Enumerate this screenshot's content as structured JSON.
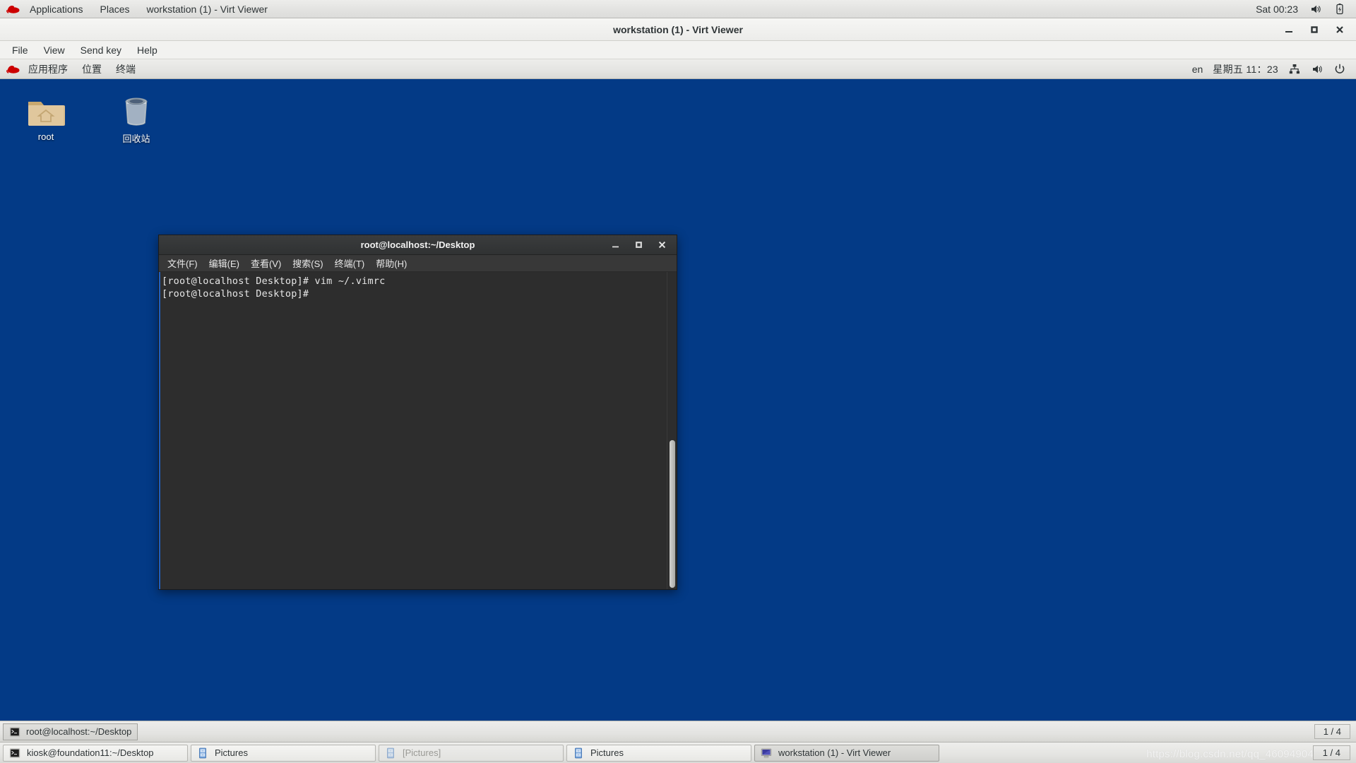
{
  "host": {
    "top_panel": {
      "logo_icon": "redhat-logo-icon",
      "menu": [
        {
          "label": "Applications",
          "name": "host-menu-applications"
        },
        {
          "label": "Places",
          "name": "host-menu-places"
        },
        {
          "label": "workstation (1) - Virt Viewer",
          "name": "host-menu-window-title"
        }
      ],
      "clock": "Sat 00:23",
      "tray": [
        {
          "icon": "volume-icon",
          "name": "host-tray-volume"
        },
        {
          "icon": "battery-charging-icon",
          "name": "host-tray-battery"
        }
      ]
    },
    "bottom_panel": {
      "tasks": [
        {
          "label": "kiosk@foundation11:~/Desktop",
          "icon": "terminal-icon",
          "state": "normal"
        },
        {
          "label": "Pictures",
          "icon": "file-manager-icon",
          "state": "normal"
        },
        {
          "label": "[Pictures]",
          "icon": "file-manager-icon",
          "state": "minimized"
        },
        {
          "label": "Pictures",
          "icon": "file-manager-icon",
          "state": "normal"
        },
        {
          "label": "workstation (1) - Virt Viewer",
          "icon": "display-icon",
          "state": "active"
        }
      ],
      "workspace_indicator": "1 / 4",
      "watermark": "https://blog.csdn.net/qq_46094904"
    }
  },
  "virt_viewer": {
    "title": "workstation (1) - Virt Viewer",
    "window_buttons": [
      {
        "icon": "minimize-icon",
        "name": "virt-viewer-minimize-button"
      },
      {
        "icon": "maximize-icon",
        "name": "virt-viewer-maximize-button"
      },
      {
        "icon": "close-icon",
        "name": "virt-viewer-close-button"
      }
    ],
    "menu": [
      {
        "label": "File",
        "name": "virt-viewer-menu-file"
      },
      {
        "label": "View",
        "name": "virt-viewer-menu-view"
      },
      {
        "label": "Send key",
        "name": "virt-viewer-menu-send-key"
      },
      {
        "label": "Help",
        "name": "virt-viewer-menu-help"
      }
    ]
  },
  "guest": {
    "desktop_background": "#033a86",
    "top_panel": {
      "logo_icon": "redhat-logo-icon",
      "menu": [
        {
          "label": "应用程序",
          "name": "guest-menu-applications"
        },
        {
          "label": "位置",
          "name": "guest-menu-places"
        },
        {
          "label": "终端",
          "name": "guest-menu-terminal"
        }
      ],
      "input_method": "en",
      "clock": "星期五 11：23",
      "tray": [
        {
          "icon": "network-icon",
          "name": "guest-tray-network"
        },
        {
          "icon": "volume-icon",
          "name": "guest-tray-volume"
        },
        {
          "icon": "power-icon",
          "name": "guest-tray-power"
        }
      ]
    },
    "desktop_icons": [
      {
        "label": "root",
        "icon": "home-folder-icon"
      },
      {
        "label": "回收站",
        "icon": "trash-icon"
      }
    ],
    "bottom_panel": {
      "tasks": [
        {
          "label": "root@localhost:~/Desktop",
          "icon": "terminal-icon",
          "state": "active"
        }
      ],
      "workspace_indicator": "1 / 4"
    }
  },
  "terminal": {
    "title": "root@localhost:~/Desktop",
    "window_buttons": [
      {
        "icon": "minimize-icon",
        "name": "terminal-minimize-button"
      },
      {
        "icon": "maximize-icon",
        "name": "terminal-maximize-button"
      },
      {
        "icon": "close-icon",
        "name": "terminal-close-button"
      }
    ],
    "menu": [
      {
        "label": "文件(F)",
        "name": "terminal-menu-file"
      },
      {
        "label": "编辑(E)",
        "name": "terminal-menu-edit"
      },
      {
        "label": "查看(V)",
        "name": "terminal-menu-view"
      },
      {
        "label": "搜索(S)",
        "name": "terminal-menu-search"
      },
      {
        "label": "终端(T)",
        "name": "terminal-menu-terminal"
      },
      {
        "label": "帮助(H)",
        "name": "terminal-menu-help"
      }
    ],
    "content": "[root@localhost Desktop]# vim ~/.vimrc\n[root@localhost Desktop]#",
    "lines": [
      "[root@localhost Desktop]# vim ~/.vimrc",
      "[root@localhost Desktop]#"
    ]
  }
}
